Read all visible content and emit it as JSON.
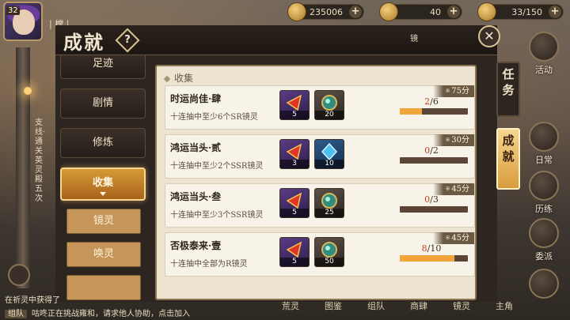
{
  "topbar": {
    "level": "32",
    "player_name": "| 樘 |",
    "resources": [
      {
        "name": "coin",
        "value": "235006"
      },
      {
        "name": "gem",
        "value": "40"
      },
      {
        "name": "stamina",
        "value": "33/150"
      }
    ]
  },
  "dialog": {
    "title": "成就",
    "help": "?",
    "close": "✕",
    "header_mark": "镜"
  },
  "nav": {
    "items": [
      {
        "label": "足迹"
      },
      {
        "label": "剧情"
      },
      {
        "label": "修炼"
      },
      {
        "label": "收集",
        "active": true
      }
    ],
    "sub_items": [
      {
        "label": "镜灵"
      },
      {
        "label": "唤灵"
      }
    ]
  },
  "panel": {
    "section": "收集",
    "achievements": [
      {
        "title": "时运尚佳·肆",
        "desc": "十连抽中至少6个SR镜灵",
        "points": "75分",
        "current": "2",
        "total": "/6",
        "progress": 0.33,
        "rewards": [
          {
            "icon": "red-ticket-icon",
            "qty": "5"
          },
          {
            "icon": "green-orb-icon",
            "qty": "20"
          }
        ]
      },
      {
        "title": "鸿运当头·贰",
        "desc": "十连抽中至少2个SSR镜灵",
        "points": "30分",
        "current": "0",
        "total": "/2",
        "progress": 0,
        "rewards": [
          {
            "icon": "red-ticket-icon",
            "qty": "3"
          },
          {
            "icon": "blue-crystal-icon",
            "qty": "10"
          }
        ]
      },
      {
        "title": "鸿运当头·叁",
        "desc": "十连抽中至少3个SSR镜灵",
        "points": "45分",
        "current": "0",
        "total": "/3",
        "progress": 0,
        "rewards": [
          {
            "icon": "red-ticket-icon",
            "qty": "5"
          },
          {
            "icon": "green-orb-icon",
            "qty": "25"
          }
        ]
      },
      {
        "title": "否极泰来·壹",
        "desc": "十连抽中全部为R镜灵",
        "points": "45分",
        "current": "8",
        "total": "/10",
        "progress": 0.8,
        "rewards": [
          {
            "icon": "red-ticket-icon",
            "qty": "5"
          },
          {
            "icon": "green-orb-icon",
            "qty": "50"
          }
        ]
      }
    ]
  },
  "side_tabs": {
    "task": "任务",
    "achievement": "成就"
  },
  "side_menu": [
    {
      "label": "活动"
    },
    {
      "label": "日常"
    },
    {
      "label": "历练"
    },
    {
      "label": "委派"
    }
  ],
  "bottom_nav": [
    "荒灵",
    "图鉴",
    "组队",
    "商肆",
    "镜灵",
    "主角"
  ],
  "chat": {
    "prev": "在祈灵中获得了",
    "tag": "组队",
    "message": "咕咚正在挑战雍和，请求他人协助，点击加入"
  },
  "left_quest": "支线·通关英灵殿五次",
  "colors": {
    "accent": "#d79a37",
    "progress_fill": "#f0a43a",
    "progress_current": "#c2411f"
  }
}
